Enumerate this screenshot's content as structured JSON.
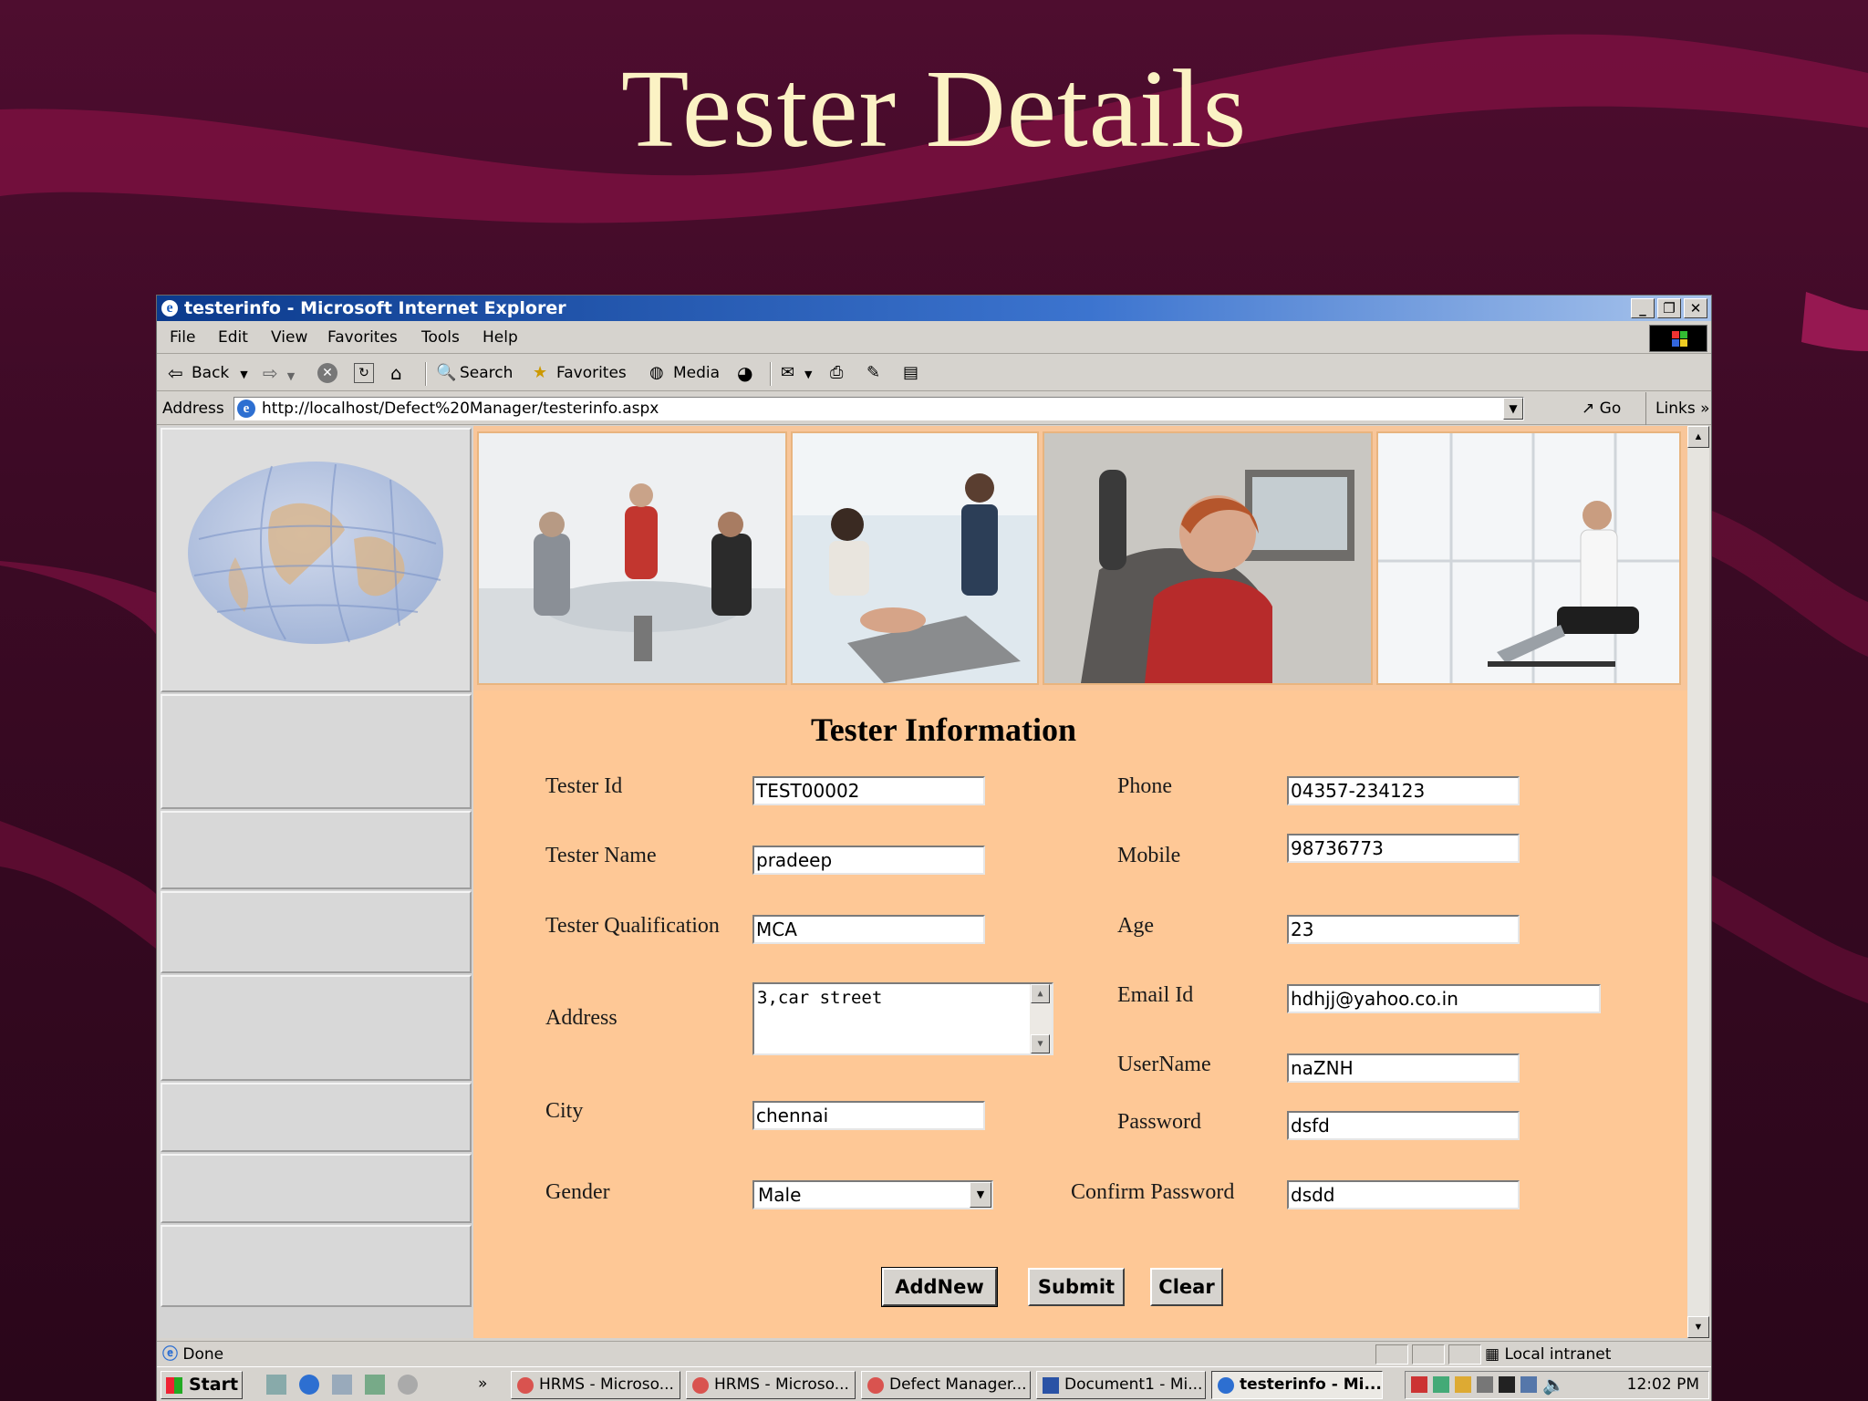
{
  "slide": {
    "title": "Tester Details"
  },
  "window": {
    "title": "testerinfo - Microsoft Internet Explorer",
    "controls": {
      "minimize": "_",
      "restore": "❐",
      "close": "✕"
    }
  },
  "menu": [
    "File",
    "Edit",
    "View",
    "Favorites",
    "Tools",
    "Help"
  ],
  "toolbar": {
    "back": "Back",
    "search": "Search",
    "favorites": "Favorites",
    "media": "Media"
  },
  "address": {
    "label": "Address",
    "url": "http://localhost/Defect%20Manager/testerinfo.aspx",
    "go": "Go",
    "links": "Links"
  },
  "form": {
    "heading": "Tester Information",
    "tester_id": {
      "label": "Tester Id",
      "value": "TEST00002"
    },
    "tester_name": {
      "label": "Tester Name",
      "value": "pradeep"
    },
    "qualification": {
      "label": "Tester Qualification",
      "value": "MCA"
    },
    "address": {
      "label": "Address",
      "value": "3,car street"
    },
    "city": {
      "label": "City",
      "value": "chennai"
    },
    "gender": {
      "label": "Gender",
      "value": "Male"
    },
    "phone": {
      "label": "Phone",
      "value": "04357-234123"
    },
    "mobile": {
      "label": "Mobile",
      "value": "98736773"
    },
    "age": {
      "label": "Age",
      "value": "23"
    },
    "email": {
      "label": "Email Id",
      "value": "hdhjj@yahoo.co.in"
    },
    "username": {
      "label": "UserName",
      "value": "naZNH"
    },
    "password": {
      "label": "Password",
      "value": "dsfd"
    },
    "confirm_password": {
      "label": "Confirm Password",
      "value": "dsdd"
    },
    "buttons": {
      "addnew": "AddNew",
      "submit": "Submit",
      "clear": "Clear"
    }
  },
  "status": {
    "text": "Done",
    "zone": "Local intranet"
  },
  "taskbar": {
    "start": "Start",
    "tasks": [
      "HRMS - Microso...",
      "HRMS - Microso...",
      "Defect Manager...",
      "Document1 - Mi...",
      "testerinfo - Mi..."
    ],
    "clock": "12:02 PM",
    "overflow": "»"
  },
  "colors": {
    "slide_bg": "#3c0a25",
    "slide_title": "#fbf2c4",
    "form_bg": "#fec896",
    "titlebar": "#0b3a8c"
  }
}
